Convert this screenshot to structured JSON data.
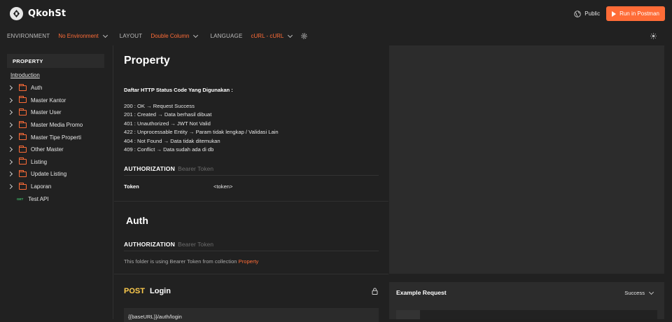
{
  "header": {
    "brand": "QkohSt",
    "visibility": "Public",
    "run_button": "Run in Postman",
    "icons": [
      "logo-icon",
      "globe-icon",
      "play-icon",
      "theme-sun-icon"
    ],
    "colors": {
      "accent": "#ff6c37",
      "post": "#ffcc4d",
      "get": "#3fbf6b",
      "background": "#212121"
    }
  },
  "toolbar": {
    "environment_label": "ENVIRONMENT",
    "environment_value": "No Environment",
    "layout_label": "LAYOUT",
    "layout_value": "Double Column",
    "language_label": "LANGUAGE",
    "language_value": "cURL - cURL"
  },
  "sidebar": {
    "heading": "PROPERTY",
    "intro": "Introduction",
    "folders": [
      {
        "label": "Auth"
      },
      {
        "label": "Master Kantor"
      },
      {
        "label": "Master User"
      },
      {
        "label": "Master Media Promo"
      },
      {
        "label": "Master Tipe Properti"
      },
      {
        "label": "Other Master"
      },
      {
        "label": "Listing"
      },
      {
        "label": "Update Listing"
      },
      {
        "label": "Laporan"
      }
    ],
    "request": {
      "method": "GET",
      "label": "Test API"
    }
  },
  "main": {
    "title": "Property",
    "desc_title": "Daftar HTTP Status Code Yang Digunakan :",
    "status_codes": [
      "200 : OK → Request Success",
      "201 : Created → Data berhasil dibuat",
      "401 : Unauthorized → JWT Not Valid",
      "422 : Unprocessable Entity → Param tidak lengkap / Validasi Lain",
      "404 : Not Found → Data tidak ditemukan",
      "409 : Conflict → Data sudah ada di db"
    ],
    "authorization": {
      "label": "AUTHORIZATION",
      "type": "Bearer Token",
      "key": "Token",
      "value": "<token>"
    },
    "folder": {
      "title": "Auth",
      "auth_label": "AUTHORIZATION",
      "auth_type": "Bearer Token",
      "note": "This folder is using Bearer Token from collection ",
      "note_link": "Property"
    },
    "request": {
      "method": "POST",
      "name": "Login",
      "url": "{{baseURL}}/auth/login"
    }
  },
  "examples": {
    "title": "Example Request",
    "selected": "Success"
  }
}
